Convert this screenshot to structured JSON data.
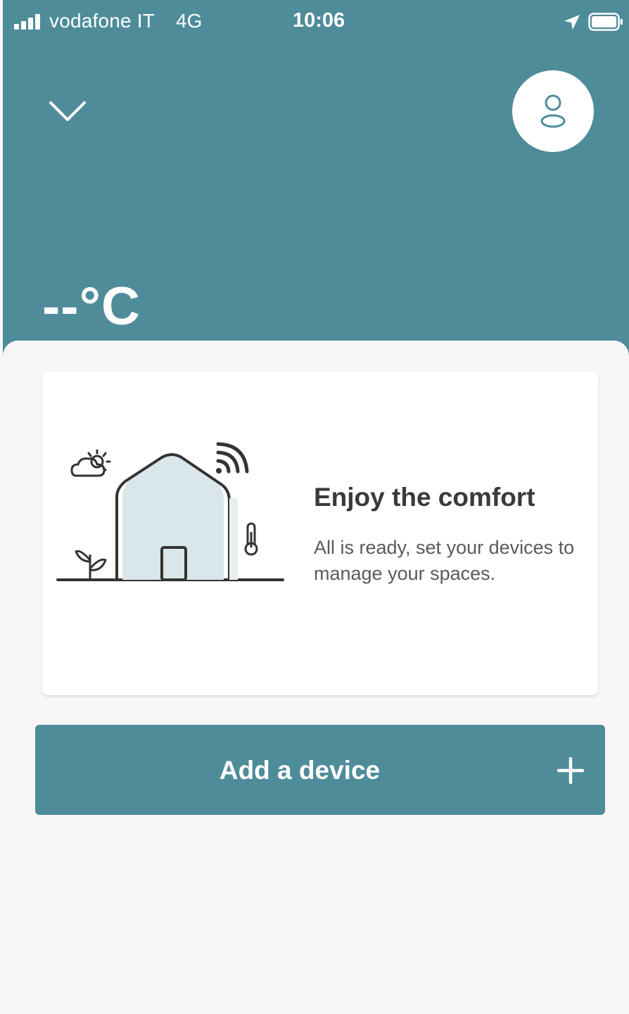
{
  "status_bar": {
    "carrier": "vodafone IT",
    "network": "4G",
    "time": "10:06",
    "icons": [
      "signal-icon",
      "location-arrow-icon",
      "battery-icon"
    ]
  },
  "header": {
    "collapse_icon": "chevron-down-icon",
    "profile_icon": "user-icon",
    "temperature": "--°C"
  },
  "card": {
    "illustration": "smart-home-illustration",
    "title": "Enjoy the comfort",
    "description": "All is ready, set your devices to manage your spaces."
  },
  "actions": {
    "add_device_label": "Add a device",
    "add_icon": "plus-icon"
  },
  "colors": {
    "primary": "#4f8c9a",
    "background": "#f7f7f7",
    "card": "#ffffff",
    "title_text": "#3a3a3a",
    "body_text": "#5a5a5a"
  }
}
